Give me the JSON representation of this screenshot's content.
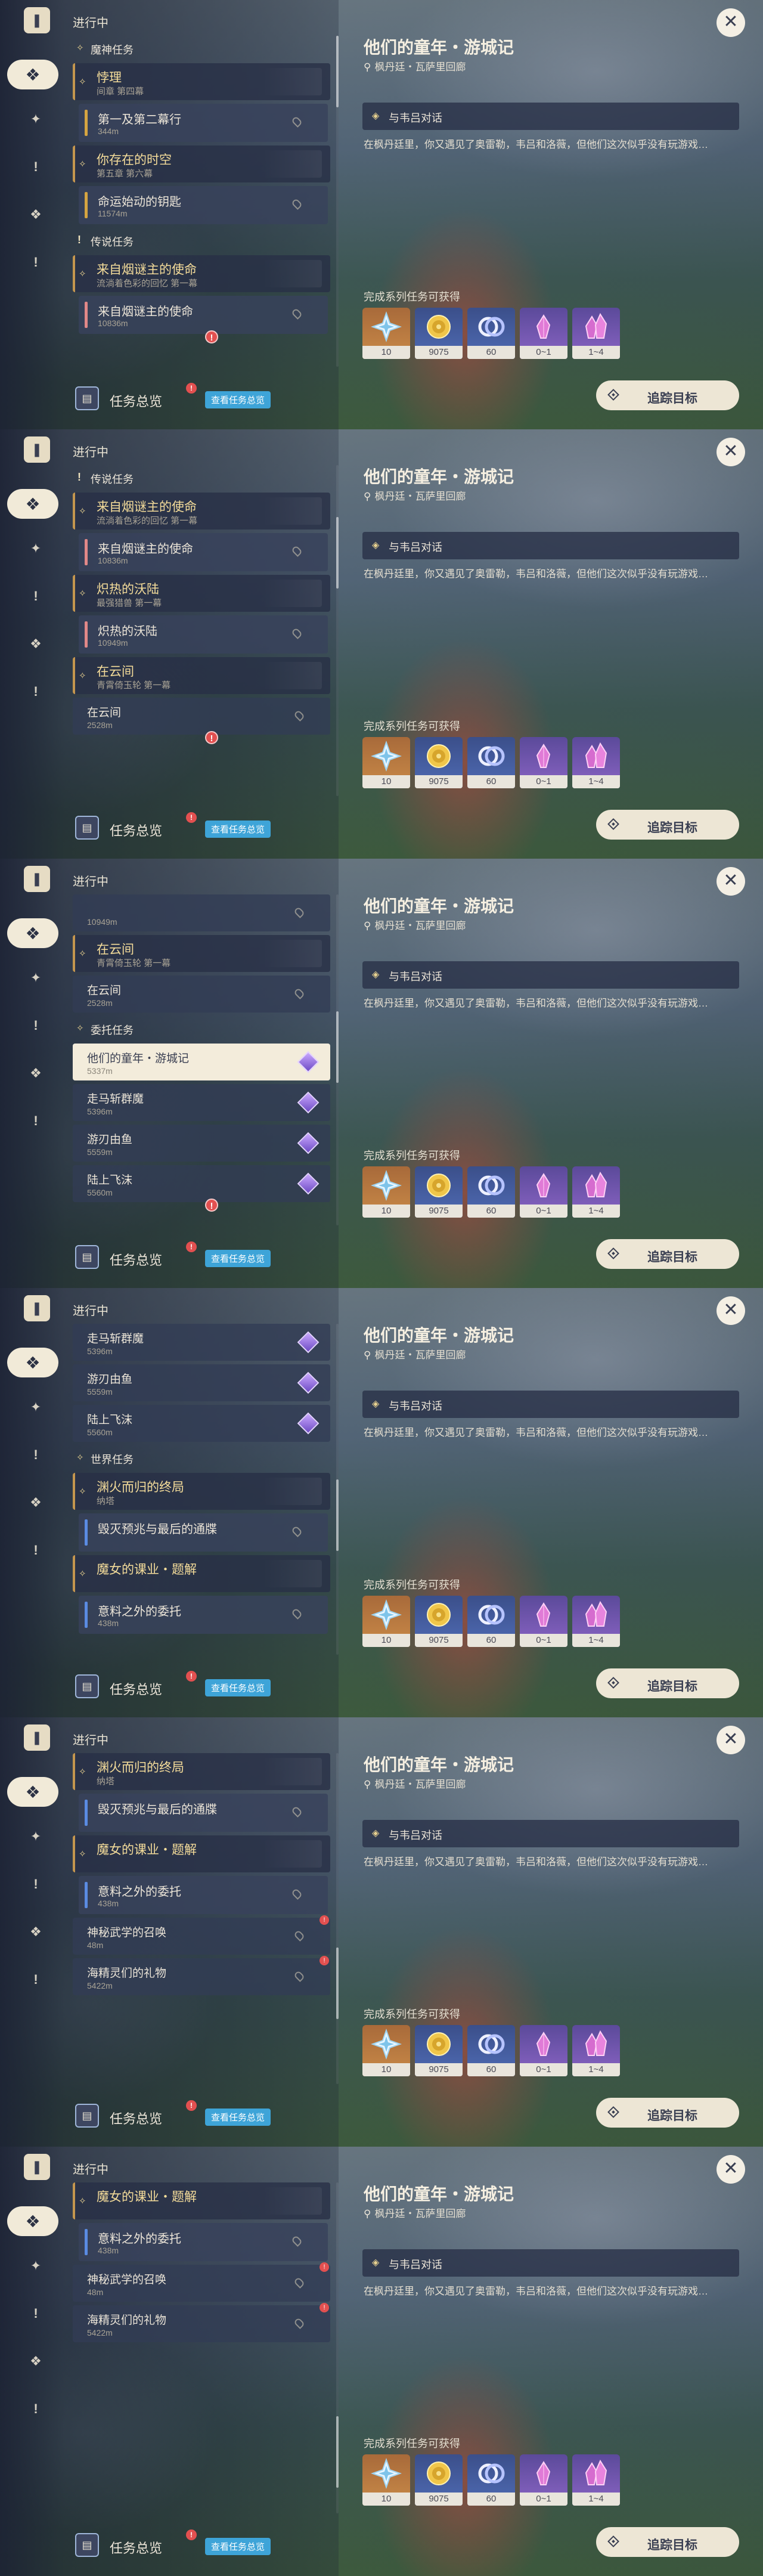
{
  "panel": {
    "title": "进行中",
    "overview_label": "任务总览",
    "overview_badge": "!",
    "view_overview_chip": "查看任务总览",
    "track_label": "追踪目标",
    "close_icon": "close-icon"
  },
  "detail": {
    "title": "他们的童年・游城记",
    "location": "枫丹廷・瓦萨里回廊",
    "step": "与韦吕对话",
    "description": "在枫丹廷里，你又遇见了奥雷勒，韦吕和洛薇，但他们这次似乎没有玩游戏…",
    "rewards_label": "完成系列任务可获得",
    "rewards": [
      {
        "item": "primogem",
        "count": "10",
        "rarity": "orange"
      },
      {
        "item": "mora",
        "count": "9075",
        "rarity": "blue"
      },
      {
        "item": "adventure-exp",
        "count": "60",
        "rarity": "blue"
      },
      {
        "item": "crystal-small",
        "count": "0~1",
        "rarity": "purple"
      },
      {
        "item": "crystal-large",
        "count": "1~4",
        "rarity": "purple"
      }
    ]
  },
  "rail_icons": [
    "quest-book-icon",
    "all-quests-icon",
    "archon-quest-icon",
    "legend-quest-icon",
    "commission-icon",
    "world-quest-icon"
  ],
  "frames": [
    {
      "active_rail": 1,
      "scroll_offset": 0,
      "scroll_thumb": 0.0,
      "items": [
        {
          "kind": "sec",
          "icon": "star",
          "text": "魔神任务"
        },
        {
          "kind": "chain",
          "title": "悖理",
          "sub": "间章 第四幕"
        },
        {
          "kind": "sub",
          "color": "gold",
          "title": "第一及第二幕行",
          "sub": "344m"
        },
        {
          "kind": "chain",
          "title": "你存在的时空",
          "sub": "第五章 第六幕"
        },
        {
          "kind": "sub",
          "color": "gold",
          "title": "命运始动的钥匙",
          "sub": "11574m"
        },
        {
          "kind": "sec",
          "icon": "bang",
          "text": "传说任务"
        },
        {
          "kind": "chain",
          "title": "来自烟谜主的使命",
          "sub": "流淌着色彩的回忆 第一幕"
        },
        {
          "kind": "sub",
          "color": "red",
          "title": "来自烟谜主的使命",
          "sub": "10836m",
          "alert": true
        }
      ]
    },
    {
      "active_rail": 1,
      "scroll_offset": 0,
      "scroll_thumb": 0.2,
      "items": [
        {
          "kind": "sec",
          "icon": "bang",
          "text": "传说任务"
        },
        {
          "kind": "chain",
          "title": "来自烟谜主的使命",
          "sub": "流淌着色彩的回忆 第一幕"
        },
        {
          "kind": "sub",
          "color": "red",
          "title": "来自烟谜主的使命",
          "sub": "10836m"
        },
        {
          "kind": "chain",
          "title": "炽热的沃陆",
          "sub": "最强猎兽 第一幕"
        },
        {
          "kind": "sub",
          "color": "red",
          "title": "炽热的沃陆",
          "sub": "10949m"
        },
        {
          "kind": "chain",
          "title": "在云间",
          "sub": "青霄倚玉轮 第一幕"
        },
        {
          "kind": "plain",
          "title": "在云间",
          "sub": "2528m",
          "alert": true
        }
      ]
    },
    {
      "active_rail": 1,
      "scroll_offset": 0,
      "scroll_thumb": 0.45,
      "items": [
        {
          "kind": "plain",
          "title": "",
          "sub": "10949m"
        },
        {
          "kind": "chain",
          "title": "在云间",
          "sub": "青霄倚玉轮 第一幕"
        },
        {
          "kind": "plain",
          "title": "在云间",
          "sub": "2528m"
        },
        {
          "kind": "sec",
          "icon": "star",
          "text": "委托任务"
        },
        {
          "kind": "comm",
          "sel": true,
          "title": "他们的童年・游城记",
          "sub": "5337m"
        },
        {
          "kind": "comm",
          "title": "走马斩群魔",
          "sub": "5396m"
        },
        {
          "kind": "comm",
          "title": "游刃由鱼",
          "sub": "5559m"
        },
        {
          "kind": "comm",
          "title": "陆上飞沫",
          "sub": "5560m",
          "alert": true
        }
      ]
    },
    {
      "active_rail": 1,
      "scroll_offset": 0,
      "scroll_thumb": 0.6,
      "items": [
        {
          "kind": "comm",
          "title": "走马斩群魔",
          "sub": "5396m"
        },
        {
          "kind": "comm",
          "title": "游刃由鱼",
          "sub": "5559m"
        },
        {
          "kind": "comm",
          "title": "陆上飞沫",
          "sub": "5560m"
        },
        {
          "kind": "sec",
          "icon": "star",
          "text": "世界任务"
        },
        {
          "kind": "chain",
          "title": "渊火而归的终局",
          "sub": "纳塔"
        },
        {
          "kind": "sub",
          "color": "blue",
          "title": "毁灭预兆与最后的通牒",
          "sub": ""
        },
        {
          "kind": "chain",
          "title": "魔女的课业・题解",
          "sub": ""
        },
        {
          "kind": "sub",
          "color": "blue",
          "title": "意料之外的委托",
          "sub": "438m"
        }
      ]
    },
    {
      "active_rail": 1,
      "scroll_offset": 0,
      "scroll_thumb": 0.75,
      "items": [
        {
          "kind": "chain",
          "title": "渊火而归的终局",
          "sub": "纳塔"
        },
        {
          "kind": "sub",
          "color": "blue",
          "title": "毁灭预兆与最后的通牒",
          "sub": ""
        },
        {
          "kind": "chain",
          "title": "魔女的课业・题解",
          "sub": ""
        },
        {
          "kind": "sub",
          "color": "blue",
          "title": "意料之外的委托",
          "sub": "438m"
        },
        {
          "kind": "plain",
          "title": "神秘武学的召唤",
          "sub": "48m",
          "badge": "!"
        },
        {
          "kind": "plain",
          "title": "海精灵们的礼物",
          "sub": "5422m",
          "badge": "!"
        }
      ]
    },
    {
      "active_rail": 1,
      "scroll_offset": 0,
      "scroll_thumb": 0.9,
      "items": [
        {
          "kind": "chain",
          "title": "魔女的课业・题解",
          "sub": ""
        },
        {
          "kind": "sub",
          "color": "blue",
          "title": "意料之外的委托",
          "sub": "438m"
        },
        {
          "kind": "plain",
          "title": "神秘武学的召唤",
          "sub": "48m",
          "badge": "!"
        },
        {
          "kind": "plain",
          "title": "海精灵们的礼物",
          "sub": "5422m",
          "badge": "!"
        }
      ]
    }
  ]
}
